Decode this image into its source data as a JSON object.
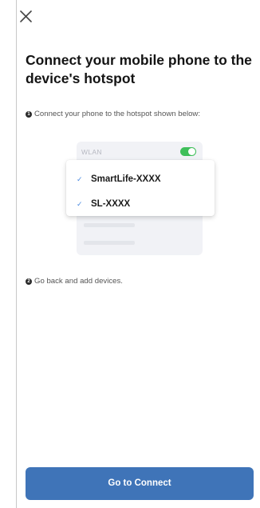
{
  "close_icon": "close-icon",
  "title": "Connect your mobile phone to the device's hotspot",
  "steps": [
    {
      "number": "1",
      "text": "Connect your phone to the hotspot shown below:"
    },
    {
      "number": "2",
      "text": "Go back and add devices."
    }
  ],
  "illustration": {
    "wlan_label": "WLAN",
    "toggle_state": "on",
    "toggle_color": "#3fbf5a",
    "networks": [
      {
        "name": "SmartLife-XXXX",
        "icon": "check-icon"
      },
      {
        "name": "SL-XXXX",
        "icon": "check-icon"
      }
    ]
  },
  "button": {
    "label": "Go to Connect",
    "color": "#3f74b8"
  }
}
